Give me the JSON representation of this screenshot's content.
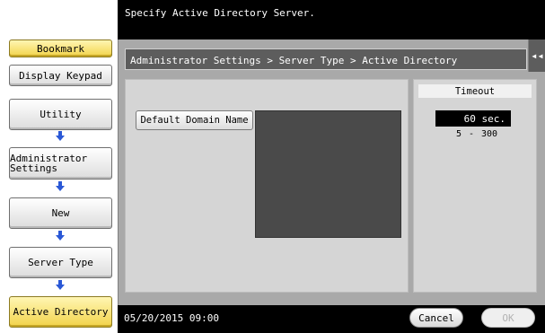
{
  "header": {
    "message": "Specify Active Directory Server."
  },
  "left_panel": {
    "bookmark_label": "Bookmark",
    "display_keypad_label": "Display Keypad",
    "breadcrumb": [
      {
        "label": "Utility"
      },
      {
        "label": "Administrator Settings"
      },
      {
        "label": "New"
      },
      {
        "label": "Server Type"
      },
      {
        "label": "Active Directory"
      }
    ]
  },
  "main": {
    "title": "Administrator Settings > Server Type > Active Directory",
    "default_domain_button": "Default Domain Name",
    "timeout": {
      "label": "Timeout",
      "value": "60 sec.",
      "range_min": "5",
      "range_sep": "-",
      "range_max": "300"
    }
  },
  "footer": {
    "datetime": "05/20/2015  09:00",
    "cancel_label": "Cancel",
    "ok_label": "OK"
  },
  "colors": {
    "accent_yellow": "#f2d34a",
    "panel_gray": "#a9a9a9",
    "title_gray": "#5d5d5d",
    "arrow_blue": "#2a58d6"
  },
  "icons": [
    "arrow-down-icon",
    "collapse-left-icon"
  ]
}
